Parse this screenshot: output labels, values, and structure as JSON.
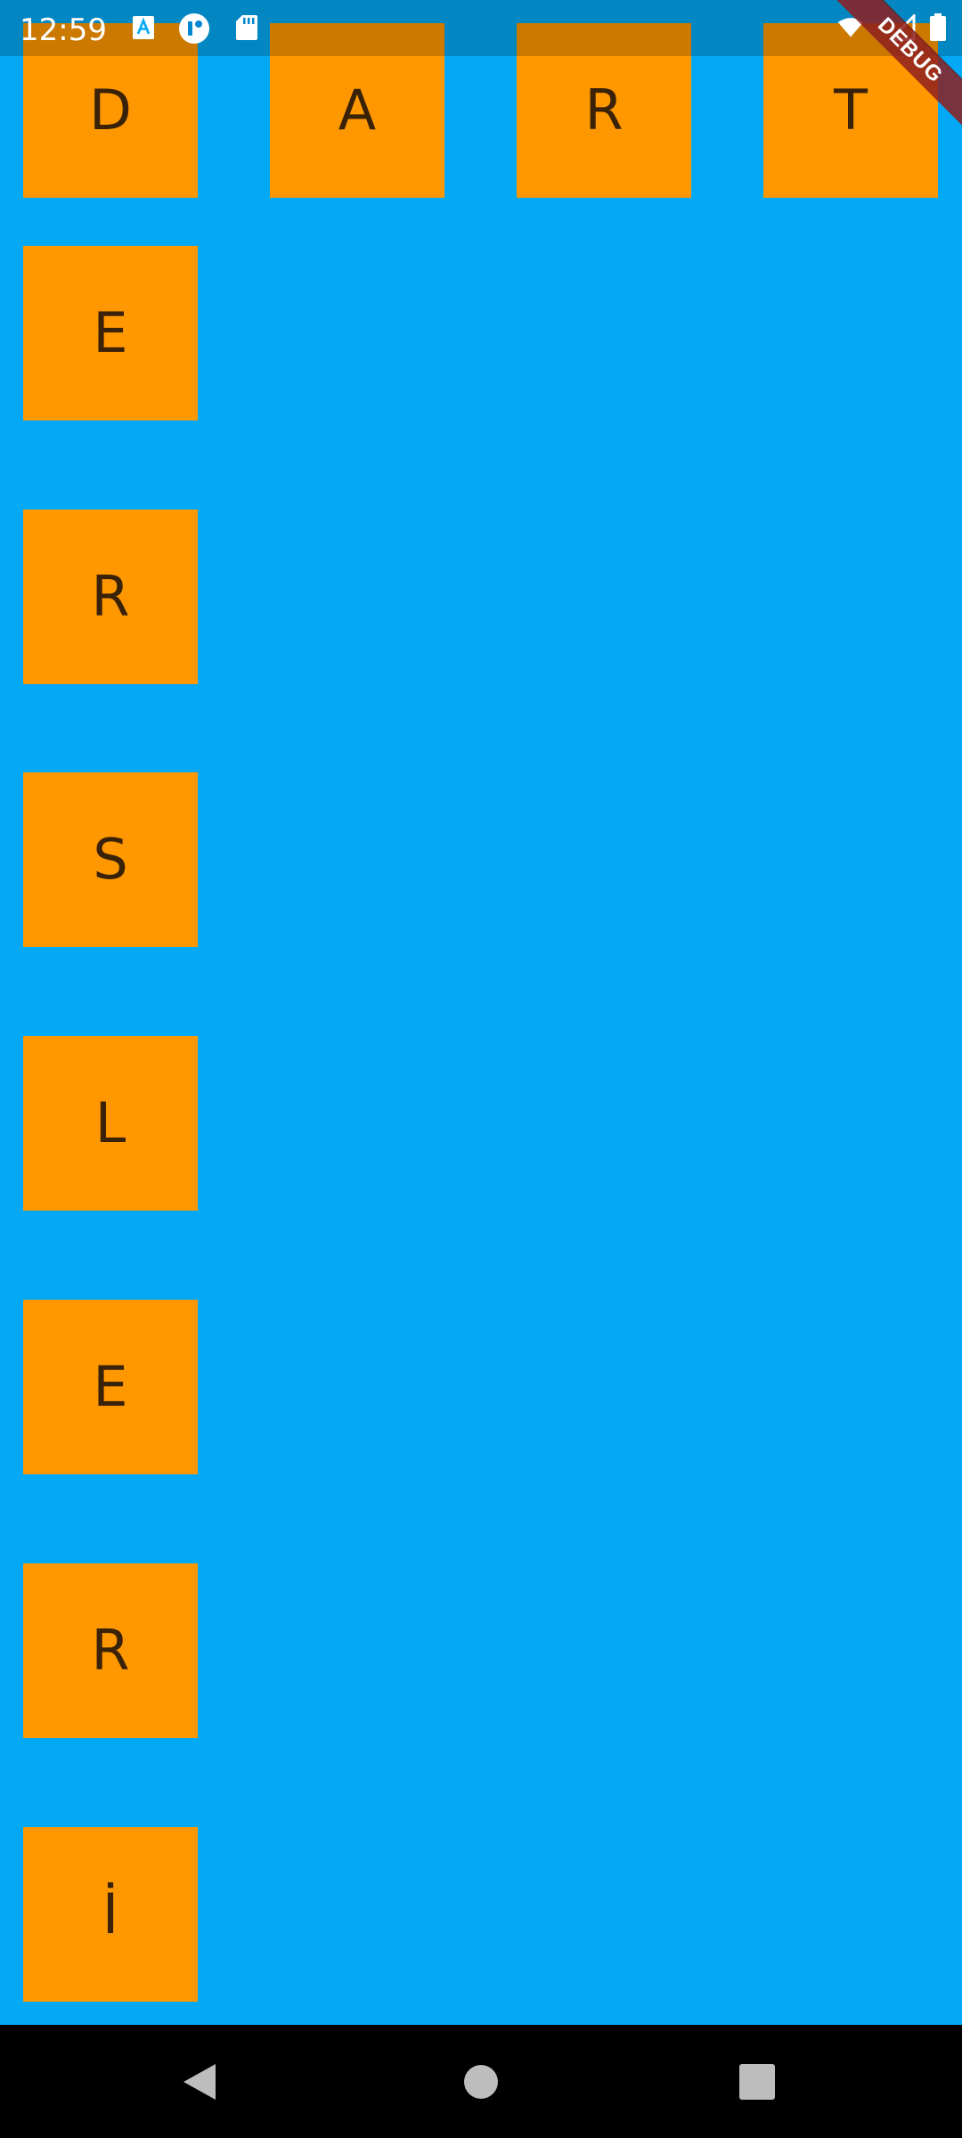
{
  "status_bar": {
    "time": "12:59",
    "icons": [
      "font-a-icon",
      "m-notification-icon",
      "sd-card-icon",
      "wifi-icon",
      "signal-icon",
      "battery-icon"
    ]
  },
  "debug_banner": {
    "label": "DEBUG"
  },
  "tiles": {
    "top_row": [
      "D",
      "A",
      "R",
      "T"
    ],
    "column": [
      "E",
      "R",
      "S",
      "L",
      "E",
      "R",
      "İ"
    ]
  },
  "navigation": {
    "buttons": [
      "back-icon",
      "home-icon",
      "recents-icon"
    ]
  },
  "colors": {
    "background": "#03A9F4",
    "tile": "#FF9800",
    "tile_text": "#3a2208",
    "nav_bar": "#000000",
    "debug_banner": "#8E1E1E"
  }
}
